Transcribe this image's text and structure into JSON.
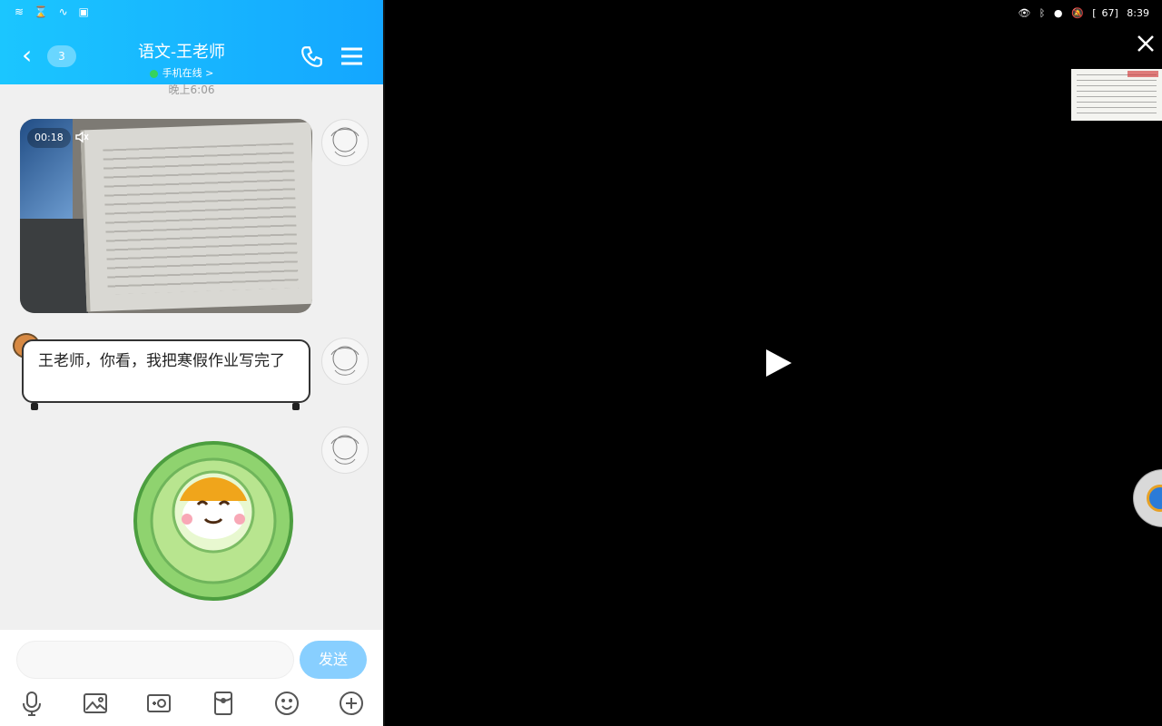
{
  "status_bar": {
    "left_icons": [
      "wifi-icon",
      "hourglass-icon",
      "app-icon",
      "calendar-icon"
    ],
    "time": "8:39",
    "battery": "67"
  },
  "chat": {
    "back_count": "3",
    "title": "语文-王老师",
    "status": "手机在线 >",
    "timestamp": "晚上6:06",
    "video": {
      "duration": "00:18"
    },
    "message_text": "王老师，你看，我把寒假作业写完了",
    "input_placeholder": "",
    "send_label": "发送"
  },
  "colors": {
    "topbar": "#14a6ff",
    "send_button": "#88cfff",
    "background": "#f0f0f0"
  }
}
